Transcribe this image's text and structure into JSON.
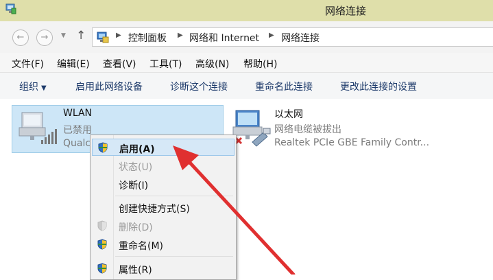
{
  "window": {
    "title": "网络连接",
    "title_bar_color": "#dfdfaa",
    "icon": "network-connections-icon"
  },
  "navigation": {
    "back_icon": "arrow-left-icon",
    "forward_icon": "arrow-right-icon",
    "recent_icon": "chevron-down-icon",
    "up_icon": "arrow-up-icon",
    "breadcrumbs": [
      "控制面板",
      "网络和 Internet",
      "网络连接"
    ]
  },
  "menubar": {
    "items": [
      "文件(F)",
      "编辑(E)",
      "查看(V)",
      "工具(T)",
      "高级(N)",
      "帮助(H)"
    ]
  },
  "commandbar": {
    "items": [
      "组织",
      "启用此网络设备",
      "诊断这个连接",
      "重命名此连接",
      "更改此连接的设置"
    ],
    "text_color": "#1e3b6b"
  },
  "connections": [
    {
      "name": "WLAN",
      "status": "已禁用",
      "device": "Qualc",
      "icon": "wireless-adapter-icon",
      "selected": true
    },
    {
      "name": "以太网",
      "status": "网络电缆被拔出",
      "device": "Realtek PCIe GBE Family Contr...",
      "icon": "ethernet-adapter-icon",
      "selected": false
    }
  ],
  "context_menu": {
    "items": [
      {
        "label": "启用(A)",
        "icon": "uac-shield-icon",
        "bold": true,
        "highlighted": true,
        "disabled": false
      },
      {
        "label": "状态(U)",
        "icon": "",
        "bold": false,
        "highlighted": false,
        "disabled": true
      },
      {
        "label": "诊断(I)",
        "icon": "",
        "bold": false,
        "highlighted": false,
        "disabled": false
      },
      {
        "label": "创建快捷方式(S)",
        "icon": "",
        "bold": false,
        "highlighted": false,
        "disabled": false
      },
      {
        "label": "删除(D)",
        "icon": "uac-shield-icon",
        "bold": false,
        "highlighted": false,
        "disabled": true
      },
      {
        "label": "重命名(M)",
        "icon": "uac-shield-icon",
        "bold": false,
        "highlighted": false,
        "disabled": false
      },
      {
        "label": "属性(R)",
        "icon": "uac-shield-icon",
        "bold": false,
        "highlighted": false,
        "disabled": false
      }
    ]
  },
  "annotation": {
    "arrow_color": "#e03030",
    "icon": "red-pointer-arrow"
  }
}
